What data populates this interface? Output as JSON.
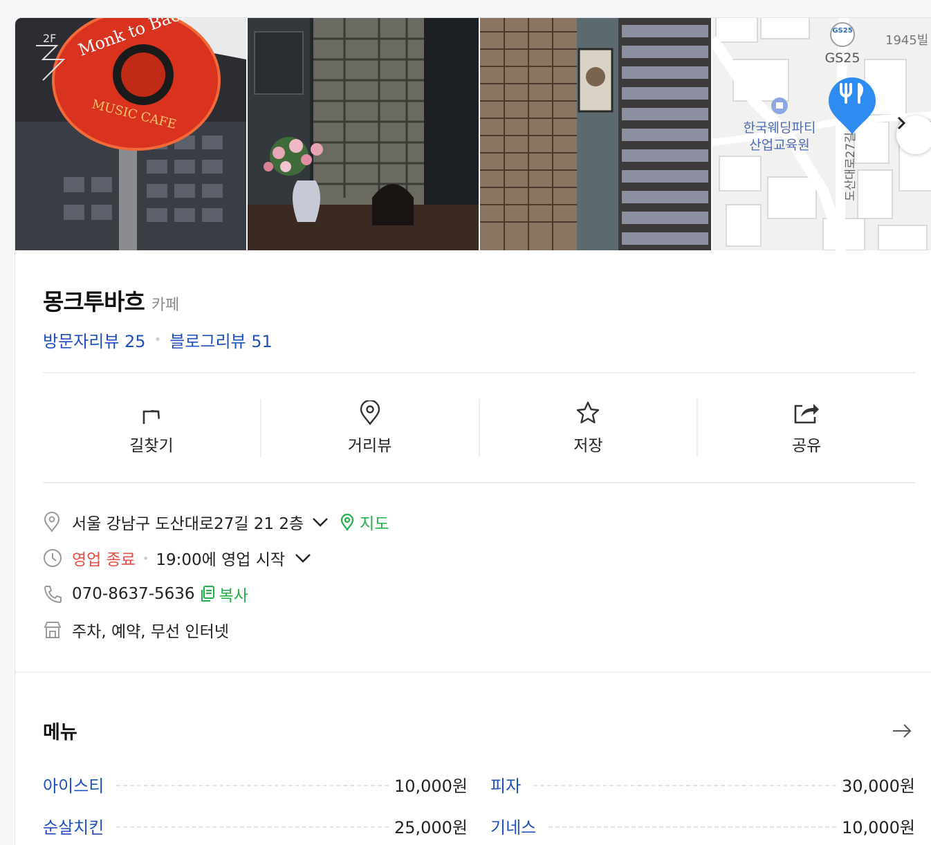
{
  "place": {
    "name": "몽크투바흐",
    "category": "카페",
    "visitor_review": "방문자리뷰 25",
    "blog_review": "블로그리뷰 51"
  },
  "photos": {
    "sign_text_2f": "2F",
    "sign_text_monk": "Monk to Bach",
    "sign_text_music": "MUSIC CAFE"
  },
  "map": {
    "gs_badge": "GS25",
    "gs_label": "GS25",
    "building": "1945빌",
    "poi_line1": "한국웨딩파티",
    "poi_line2": "산업교육원",
    "street": "도산대로27길"
  },
  "actions": [
    {
      "label": "길찾기",
      "icon": "directions-icon"
    },
    {
      "label": "거리뷰",
      "icon": "pin-icon"
    },
    {
      "label": "저장",
      "icon": "star-icon"
    },
    {
      "label": "공유",
      "icon": "share-icon"
    }
  ],
  "details": {
    "address": "서울 강남구 도산대로27길 21 2층",
    "map_link": "지도",
    "status": "영업 종료",
    "hours": "19:00에 영업 시작",
    "phone": "070-8637-5636",
    "copy_label": "복사",
    "amenities": "주차, 예약, 무선 인터넷"
  },
  "menu": {
    "title": "메뉴",
    "items": [
      {
        "name": "아이스티",
        "price": "10,000원"
      },
      {
        "name": "피자",
        "price": "30,000원"
      },
      {
        "name": "순살치킨",
        "price": "25,000원"
      },
      {
        "name": "기네스",
        "price": "10,000원"
      }
    ]
  },
  "colors": {
    "link_blue": "#1e4fbf",
    "green": "#1fb04a",
    "closed_red": "#ea4b44",
    "map_pin": "#2e8cf0"
  }
}
